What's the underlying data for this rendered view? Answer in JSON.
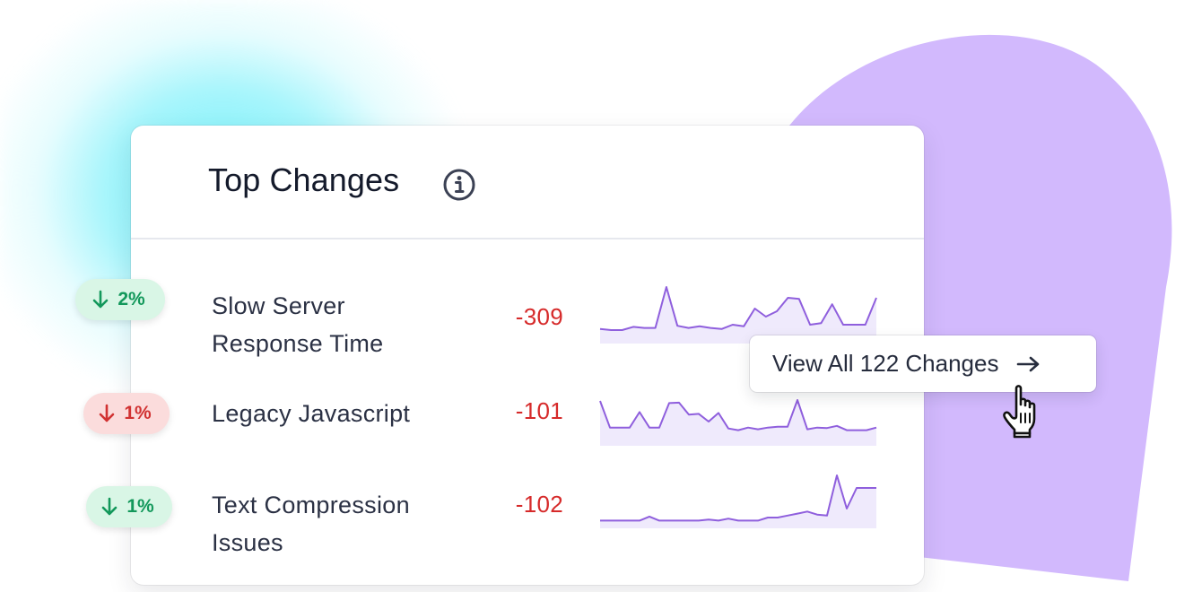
{
  "card": {
    "title": "Top Changes",
    "info_icon": "info-icon"
  },
  "rows": [
    {
      "badge": {
        "direction": "down",
        "text": "2%",
        "tone": "positive",
        "color": "#13985b",
        "background": "#d9f6e6"
      },
      "label": "Slow Server Response Time",
      "value": "-309",
      "sparkline": [
        0.22,
        0.2,
        0.2,
        0.26,
        0.24,
        0.24,
        1.0,
        0.28,
        0.24,
        0.27,
        0.24,
        0.22,
        0.3,
        0.27,
        0.6,
        0.45,
        0.55,
        0.8,
        0.78,
        0.3,
        0.33,
        0.68,
        0.3,
        0.3,
        0.3,
        0.8
      ]
    },
    {
      "badge": {
        "direction": "down",
        "text": "1%",
        "tone": "negative",
        "color": "#d13232",
        "background": "#fbdcdc"
      },
      "label": "Legacy Javascript",
      "value": "-101",
      "sparkline": [
        0.98,
        0.36,
        0.36,
        0.36,
        0.72,
        0.36,
        0.36,
        0.93,
        0.94,
        0.66,
        0.68,
        0.5,
        0.7,
        0.34,
        0.3,
        0.36,
        0.32,
        0.36,
        0.38,
        0.38,
        1.0,
        0.32,
        0.36,
        0.35,
        0.4,
        0.3,
        0.3,
        0.3,
        0.36
      ]
    },
    {
      "badge": {
        "direction": "down",
        "text": "1%",
        "tone": "positive",
        "color": "#13985b",
        "background": "#d9f6e6"
      },
      "label": "Text Compression Issues",
      "value": "-102",
      "sparkline": [
        0.1,
        0.1,
        0.1,
        0.1,
        0.1,
        0.18,
        0.1,
        0.1,
        0.1,
        0.1,
        0.1,
        0.12,
        0.1,
        0.14,
        0.1,
        0.1,
        0.1,
        0.16,
        0.16,
        0.2,
        0.24,
        0.28,
        0.22,
        0.2,
        1.0,
        0.34,
        0.75,
        0.75,
        0.75
      ]
    }
  ],
  "view_all": {
    "label": "View All 122 Changes",
    "icon": "arrow-right-icon"
  },
  "cursor": {
    "icon": "hand-pointer-icon"
  },
  "colors": {
    "accent_purple": "#8f5fdd",
    "sparkline_fill": "#efeafc",
    "blob_purple": "#d2b9fd",
    "glow_cyan": "#68f0fa",
    "negative_value": "#d62a2a"
  }
}
